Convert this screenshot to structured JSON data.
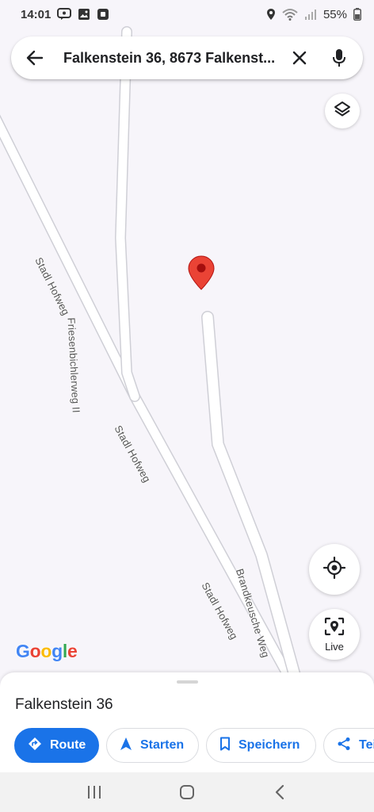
{
  "status_bar": {
    "time": "14:01",
    "battery": "55%",
    "icons": [
      "chat-notification-icon",
      "gallery-icon",
      "app-notification-icon",
      "location-icon",
      "wifi-icon",
      "signal-icon",
      "battery-icon"
    ]
  },
  "search": {
    "query": "Falkenstein 36, 8673 Falkenst..."
  },
  "map": {
    "road_labels": [
      "Stadl Hofweg",
      "Friesenbichlerweg II",
      "Stadl Hofweg",
      "Stadl Hofweg",
      "Brandkeusche Weg"
    ],
    "pin_color": "#ea4335"
  },
  "live_button": {
    "label": "Live"
  },
  "google_logo": [
    "G",
    "o",
    "o",
    "g",
    "l",
    "e"
  ],
  "place_sheet": {
    "title": "Falkenstein 36",
    "actions": {
      "route": "Route",
      "start": "Starten",
      "save": "Speichern",
      "share": "Tei"
    }
  },
  "colors": {
    "accent": "#1a73e8",
    "pin": "#ea4335",
    "map_background": "#f7f5fa"
  }
}
